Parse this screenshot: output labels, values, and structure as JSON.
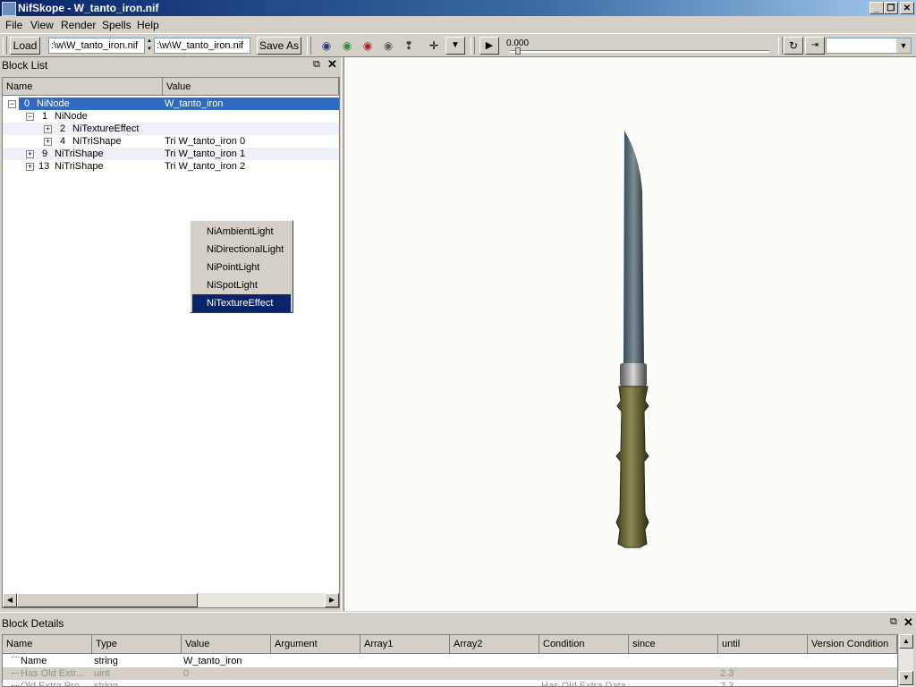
{
  "window": {
    "title": "NifSkope - W_tanto_iron.nif"
  },
  "menu": [
    "File",
    "View",
    "Render",
    "Spells",
    "Help"
  ],
  "toolbar": {
    "load_label": "Load",
    "load_path": ":\\w\\W_tanto_iron.nif",
    "save_path": ":\\w\\W_tanto_iron.nif",
    "save_as_label": "Save As",
    "time_value": "0.000",
    "icons": [
      "view-top-icon",
      "view-front-icon",
      "view-side-icon",
      "view-user-icon",
      "walk-icon",
      "move-icon",
      "more-icon",
      "play-icon",
      "loop-icon",
      "switch-icon"
    ]
  },
  "block_list": {
    "title": "Block List",
    "columns": [
      "Name",
      "Value"
    ],
    "rows": [
      {
        "index": "0",
        "name": "NiNode",
        "value": "W_tanto_iron",
        "selected": true
      },
      {
        "index": "1",
        "name": "NiNode",
        "value": ""
      },
      {
        "index": "2",
        "name": "NiTextureEffect",
        "value": ""
      },
      {
        "index": "4",
        "name": "NiTriShape",
        "value": "Tri W_tanto_iron 0"
      },
      {
        "index": "9",
        "name": "NiTriShape",
        "value": "Tri W_tanto_iron 1"
      },
      {
        "index": "13",
        "name": "NiTriShape",
        "value": "Tri W_tanto_iron 2"
      }
    ]
  },
  "context_menu": {
    "items": [
      "NiAmbientLight",
      "NiDirectionalLight",
      "NiPointLight",
      "NiSpotLight",
      "NiTextureEffect"
    ],
    "selected": "NiTextureEffect"
  },
  "block_details": {
    "title": "Block Details",
    "columns": [
      "Name",
      "Type",
      "Value",
      "Argument",
      "Array1",
      "Array2",
      "Condition",
      "since",
      "until",
      "Version Condition"
    ],
    "rows": [
      {
        "name": "Name",
        "type": "string",
        "value": "W_tanto_iron",
        "argument": "",
        "array1": "",
        "array2": "",
        "condition": "",
        "since": "",
        "until": "",
        "version_condition": ""
      },
      {
        "name": "Has Old Extr...",
        "type": "uint",
        "value": "0",
        "argument": "",
        "array1": "",
        "array2": "",
        "condition": "",
        "since": "",
        "until": "2.3",
        "version_condition": ""
      },
      {
        "name": "Old Extra Pro...",
        "type": "string",
        "value": "",
        "argument": "",
        "array1": "",
        "array2": "",
        "condition": "Has Old Extra Data",
        "since": "",
        "until": "2.3",
        "version_condition": ""
      }
    ]
  },
  "colors": {
    "selection": "#316ac5",
    "menu_highlight": "#0a246a",
    "chrome": "#d4d0c8",
    "viewport_bg": "#fcfcf9"
  }
}
